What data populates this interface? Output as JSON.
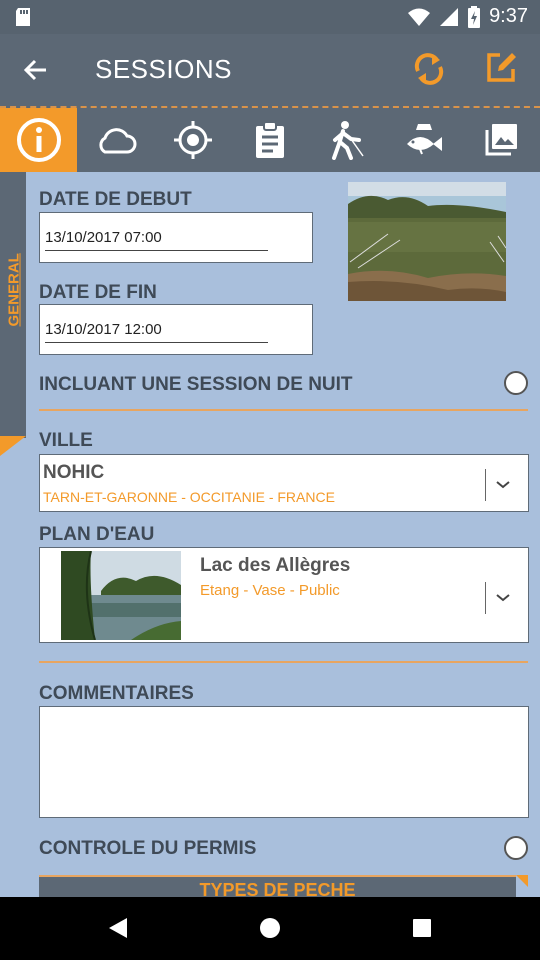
{
  "status_bar": {
    "time": "9:37",
    "icons": [
      "sd-card-icon",
      "wifi-icon",
      "signal-icon",
      "battery-charging-icon"
    ]
  },
  "app_bar": {
    "title": "SESSIONS",
    "actions": [
      "sync-icon",
      "edit-icon"
    ]
  },
  "tabs": [
    {
      "icon": "info-icon",
      "active": true
    },
    {
      "icon": "cloud-icon"
    },
    {
      "icon": "gps-target-icon"
    },
    {
      "icon": "clipboard-icon"
    },
    {
      "icon": "walking-fisherman-icon"
    },
    {
      "icon": "fish-icon"
    },
    {
      "icon": "gallery-icon"
    }
  ],
  "side_label": "GENERAL",
  "start_date": {
    "label": "DATE DE DEBUT",
    "value": "13/10/2017 07:00"
  },
  "end_date": {
    "label": "DATE DE FIN",
    "value": "13/10/2017 12:00"
  },
  "night_session": {
    "label": "INCLUANT UNE SESSION DE NUIT",
    "checked": false
  },
  "city": {
    "label": "VILLE",
    "name": "NOHIC",
    "region": "TARN-ET-GARONNE - OCCITANIE - FRANCE"
  },
  "water": {
    "label": "PLAN D'EAU",
    "name": "Lac des Allègres",
    "details": "Etang - Vase - Public"
  },
  "comments": {
    "label": "COMMENTAIRES",
    "value": ""
  },
  "permit_check": {
    "label": "CONTROLE DU PERMIS",
    "checked": false
  },
  "next_section": "TYPES DE PECHE",
  "colors": {
    "accent": "#f39a2a",
    "bar": "#5c6875",
    "background": "#a9bfdc",
    "label": "#3f4a57"
  }
}
